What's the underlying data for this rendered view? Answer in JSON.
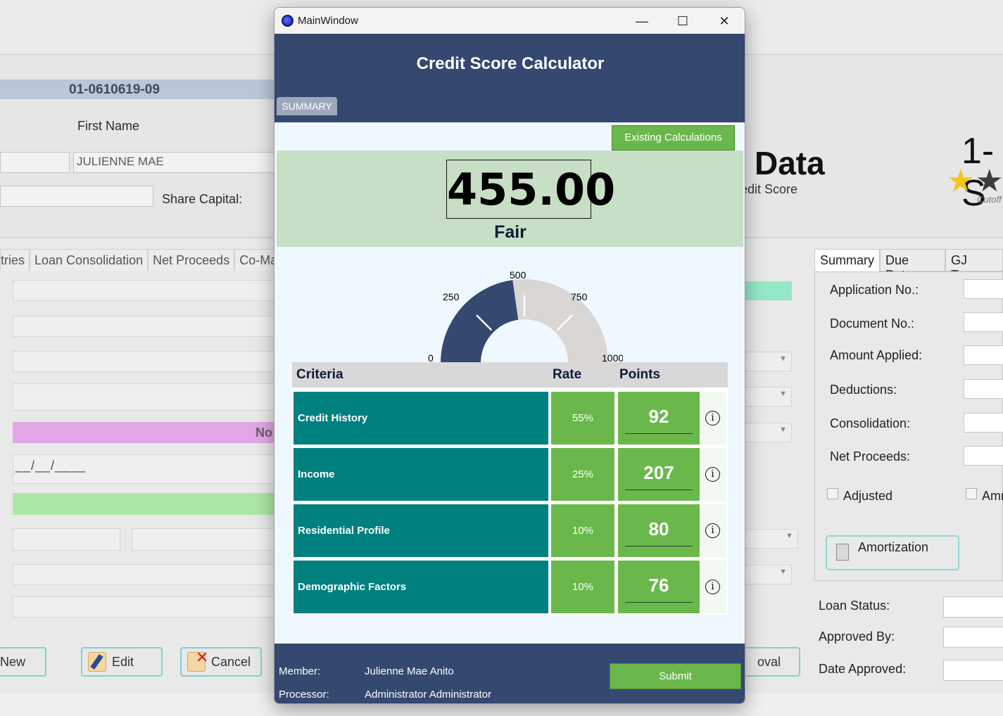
{
  "background": {
    "account_no": "01-0610619-09",
    "first_name_label": "First Name",
    "first_name_value": "JULIENNE MAE",
    "share_capital_label": "Share Capital:",
    "tabs": [
      "tries",
      "Loan Consolidation",
      "Net Proceeds",
      "Co-Ma"
    ],
    "status_fragment": "No",
    "date_mask": "__/__/____",
    "buttons": {
      "new": "New",
      "edit": "Edit",
      "cancel": "Cancel",
      "approval": "oval"
    },
    "data_title": "Data",
    "credit_score_fragment": "edit Score",
    "rank": "1-S",
    "cutoff": "Cutoff",
    "right_tabs": [
      "Summary",
      "Due Dates",
      "GJ Trans"
    ],
    "fields": {
      "application_no": "Application No.:",
      "document_no": "Document No.:",
      "amount_applied": "Amount Applied:",
      "deductions": "Deductions:",
      "consolidation": "Consolidation:",
      "net_proceeds": "Net Proceeds:",
      "adjusted": "Adjusted",
      "amr": "Amr",
      "amortization": "Amortization",
      "loan_status": "Loan Status:",
      "approved_by": "Approved By:",
      "date_approved": "Date Approved:"
    }
  },
  "window": {
    "title": "MainWindow",
    "controls": {
      "minimize": "—",
      "maximize": "☐",
      "close": "✕"
    }
  },
  "calculator": {
    "title": "Credit Score Calculator",
    "tab": "SUMMARY",
    "existing_button": "Existing Calculations",
    "score": "455.00",
    "grade": "Fair",
    "gauge": {
      "min": 0,
      "max": 1000,
      "value": 455,
      "labels": {
        "zero": "0",
        "q1": "250",
        "mid": "500",
        "q3": "750",
        "max": "1000"
      },
      "colors": {
        "filled": "#344870",
        "empty": "#d9d6d4"
      }
    },
    "table": {
      "headers": {
        "criteria": "Criteria",
        "rate": "Rate",
        "points": "Points"
      },
      "rows": [
        {
          "criteria": "Credit History",
          "rate": "55%",
          "points": "92"
        },
        {
          "criteria": "Income",
          "rate": "25%",
          "points": "207"
        },
        {
          "criteria": "Residential Profile",
          "rate": "10%",
          "points": "80"
        },
        {
          "criteria": "Demographic Factors",
          "rate": "10%",
          "points": "76"
        }
      ],
      "info_icon": "i"
    },
    "footer": {
      "member_label": "Member:",
      "member_value": "Julienne Mae Anito",
      "processor_label": "Processor:",
      "processor_value": "Administrator Administrator",
      "submit": "Submit"
    }
  },
  "colors": {
    "header": "#344870",
    "green": "#6ab84b",
    "teal": "#00807f",
    "score_panel": "#c7e0c5"
  }
}
